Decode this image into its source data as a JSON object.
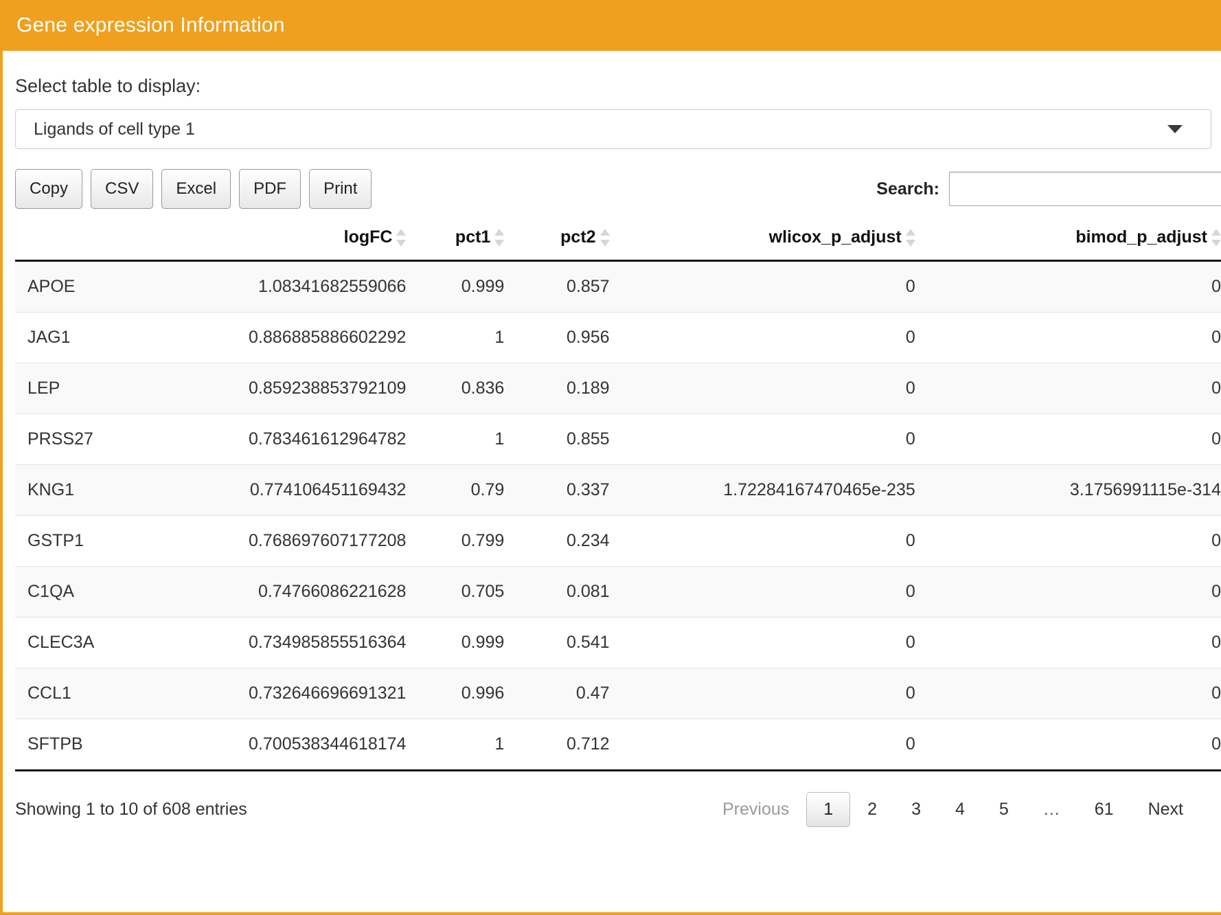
{
  "header": {
    "title": "Gene expression Information",
    "bar_color": "#f0a01e"
  },
  "select_section": {
    "label": "Select table to display:",
    "selected_value": "Ligands of cell type 1",
    "arrow_icon": "chevron-down-icon"
  },
  "toolbar": {
    "buttons": [
      {
        "label": "Copy"
      },
      {
        "label": "CSV"
      },
      {
        "label": "Excel"
      },
      {
        "label": "PDF"
      },
      {
        "label": "Print"
      }
    ],
    "search_label": "Search:",
    "search_value": "",
    "search_placeholder": ""
  },
  "table": {
    "columns": [
      {
        "label": "",
        "sortable": false
      },
      {
        "label": "logFC",
        "sortable": true
      },
      {
        "label": "pct1",
        "sortable": true
      },
      {
        "label": "pct2",
        "sortable": true
      },
      {
        "label": "wlicox_p_adjust",
        "sortable": true
      },
      {
        "label": "bimod_p_adjust",
        "sortable": true
      }
    ],
    "rows": [
      {
        "gene": "APOE",
        "logFC": "1.08341682559066",
        "pct1": "0.999",
        "pct2": "0.857",
        "wlicox_p_adjust": "0",
        "bimod_p_adjust": "0"
      },
      {
        "gene": "JAG1",
        "logFC": "0.886885886602292",
        "pct1": "1",
        "pct2": "0.956",
        "wlicox_p_adjust": "0",
        "bimod_p_adjust": "0"
      },
      {
        "gene": "LEP",
        "logFC": "0.859238853792109",
        "pct1": "0.836",
        "pct2": "0.189",
        "wlicox_p_adjust": "0",
        "bimod_p_adjust": "0"
      },
      {
        "gene": "PRSS27",
        "logFC": "0.783461612964782",
        "pct1": "1",
        "pct2": "0.855",
        "wlicox_p_adjust": "0",
        "bimod_p_adjust": "0"
      },
      {
        "gene": "KNG1",
        "logFC": "0.774106451169432",
        "pct1": "0.79",
        "pct2": "0.337",
        "wlicox_p_adjust": "1.72284167470465e-235",
        "bimod_p_adjust": "3.1756991115e-314"
      },
      {
        "gene": "GSTP1",
        "logFC": "0.768697607177208",
        "pct1": "0.799",
        "pct2": "0.234",
        "wlicox_p_adjust": "0",
        "bimod_p_adjust": "0"
      },
      {
        "gene": "C1QA",
        "logFC": "0.74766086221628",
        "pct1": "0.705",
        "pct2": "0.081",
        "wlicox_p_adjust": "0",
        "bimod_p_adjust": "0"
      },
      {
        "gene": "CLEC3A",
        "logFC": "0.734985855516364",
        "pct1": "0.999",
        "pct2": "0.541",
        "wlicox_p_adjust": "0",
        "bimod_p_adjust": "0"
      },
      {
        "gene": "CCL1",
        "logFC": "0.732646696691321",
        "pct1": "0.996",
        "pct2": "0.47",
        "wlicox_p_adjust": "0",
        "bimod_p_adjust": "0"
      },
      {
        "gene": "SFTPB",
        "logFC": "0.700538344618174",
        "pct1": "1",
        "pct2": "0.712",
        "wlicox_p_adjust": "0",
        "bimod_p_adjust": "0"
      }
    ]
  },
  "footer": {
    "info": "Showing 1 to 10 of 608 entries",
    "pagination": [
      {
        "label": "Previous",
        "state": "disabled"
      },
      {
        "label": "1",
        "state": "current"
      },
      {
        "label": "2",
        "state": "normal"
      },
      {
        "label": "3",
        "state": "normal"
      },
      {
        "label": "4",
        "state": "normal"
      },
      {
        "label": "5",
        "state": "normal"
      },
      {
        "label": "…",
        "state": "ellipsis"
      },
      {
        "label": "61",
        "state": "normal"
      },
      {
        "label": "Next",
        "state": "normal"
      }
    ]
  }
}
